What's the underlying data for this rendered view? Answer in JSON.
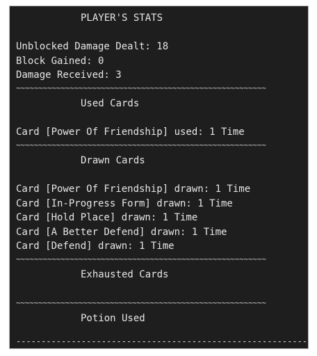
{
  "title": "PLAYER'S STATS",
  "stats": {
    "unblocked_damage": "Unblocked Damage Dealt: 18",
    "block_gained": "Block Gained: 0",
    "damage_received": "Damage Received: 3"
  },
  "separator": "~~~~~~~~~~~~~~~~~~~~~~~~~~~~~~~~~~~~~~~~~~~~~~~~~~~~~~~~",
  "sections": {
    "used_cards": {
      "heading": "Used Cards",
      "lines": [
        "Card [Power Of Friendship] used: 1 Time"
      ]
    },
    "drawn_cards": {
      "heading": "Drawn Cards",
      "lines": [
        "Card [Power Of Friendship] drawn: 1 Time",
        "Card [In-Progress Form] drawn: 1 Time",
        "Card [Hold Place] drawn: 1 Time",
        "Card [A Better Defend] drawn: 1 Time",
        "Card [Defend] drawn: 1 Time"
      ]
    },
    "exhausted_cards": {
      "heading": "Exhausted Cards",
      "lines": []
    },
    "potion_used": {
      "heading": "Potion Used",
      "lines": []
    }
  },
  "bottom_rule": "------------------------------------------------------------"
}
